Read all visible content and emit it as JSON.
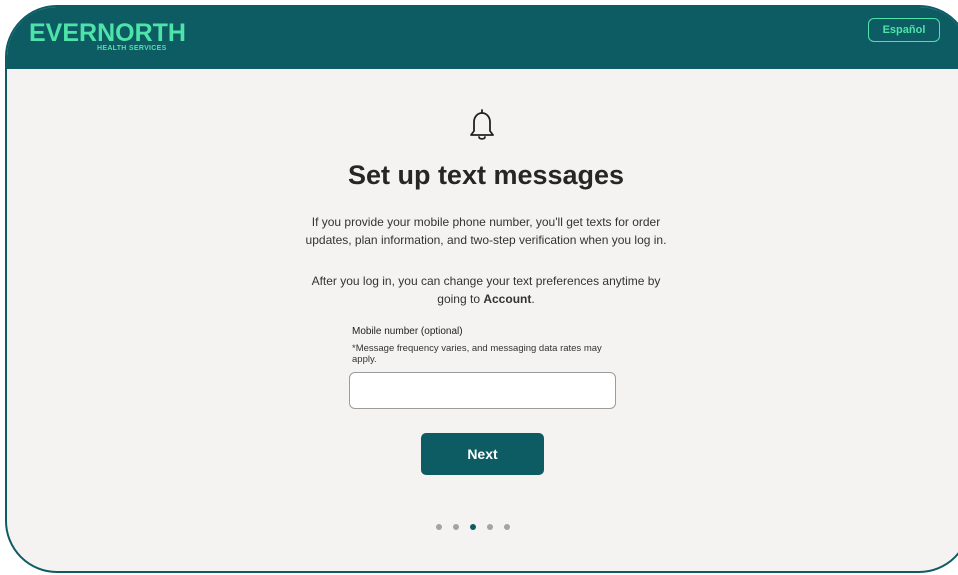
{
  "header": {
    "logo_text": "EVERNORTH",
    "logo_subtext": "HEALTH SERVICES",
    "language_button": "Español"
  },
  "main": {
    "icon": "bell-icon",
    "title": "Set up text messages",
    "paragraph1_line1": "If you provide your mobile phone number, you'll get texts for order",
    "paragraph1_line2": "updates, plan information, and two-step verification when you log in.",
    "paragraph2_line1": "After you log in, you can change your text preferences anytime by",
    "paragraph2_line2_prefix": "going to ",
    "paragraph2_account": "Account",
    "paragraph2_suffix": ".",
    "mobile_label": "Mobile number  (optional)",
    "mobile_note": "*Message frequency varies, and messaging data rates may apply.",
    "mobile_value": "",
    "next_button": "Next"
  },
  "pagination": {
    "total": 5,
    "active_index": 2
  },
  "colors": {
    "brand_teal": "#0d5c64",
    "accent_green": "#4ee3a8",
    "background": "#f4f3f1"
  }
}
